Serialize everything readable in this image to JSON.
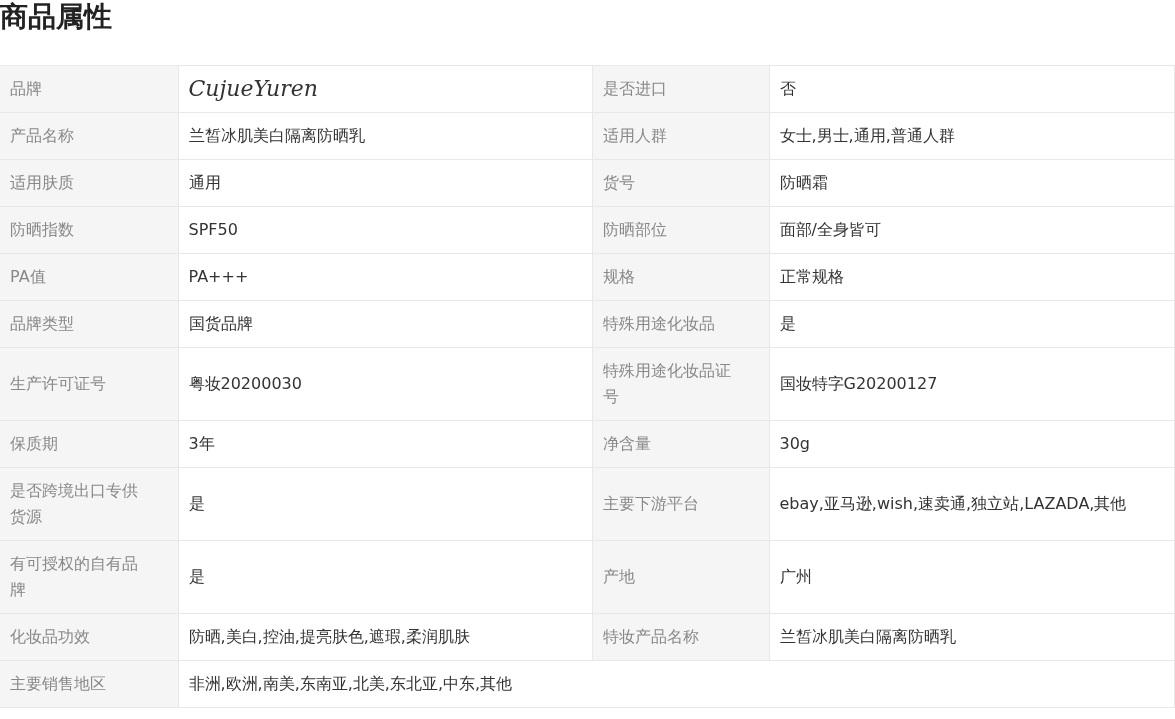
{
  "title": "商品属性",
  "rows": [
    [
      {
        "label": "品牌",
        "value": "CujueYuren",
        "kind": "brand"
      },
      {
        "label": "是否进口",
        "value": "否"
      }
    ],
    [
      {
        "label": "产品名称",
        "value": "兰皙冰肌美白隔离防晒乳"
      },
      {
        "label": "适用人群",
        "value": "女士,男士,通用,普通人群"
      }
    ],
    [
      {
        "label": "适用肤质",
        "value": "通用"
      },
      {
        "label": "货号",
        "value": "防晒霜"
      }
    ],
    [
      {
        "label": "防晒指数",
        "value": "SPF50"
      },
      {
        "label": "防晒部位",
        "value": "面部/全身皆可"
      }
    ],
    [
      {
        "label": "PA值",
        "value": "PA+++"
      },
      {
        "label": "规格",
        "value": "正常规格"
      }
    ],
    [
      {
        "label": "品牌类型",
        "value": "国货品牌"
      },
      {
        "label": "特殊用途化妆品",
        "value": "是"
      }
    ],
    [
      {
        "label": "生产许可证号",
        "value": "粤妆20200030"
      },
      {
        "label": "特殊用途化妆品证号",
        "value": "国妆特字G20200127"
      }
    ],
    [
      {
        "label": "保质期",
        "value": "3年"
      },
      {
        "label": "净含量",
        "value": "30g"
      }
    ],
    [
      {
        "label": "是否跨境出口专供货源",
        "value": "是"
      },
      {
        "label": "主要下游平台",
        "value": "ebay,亚马逊,wish,速卖通,独立站,LAZADA,其他"
      }
    ],
    [
      {
        "label": "有可授权的自有品牌",
        "value": "是"
      },
      {
        "label": "产地",
        "value": "广州"
      }
    ],
    [
      {
        "label": "化妆品功效",
        "value": "防晒,美白,控油,提亮肤色,遮瑕,柔润肌肤"
      },
      {
        "label": "特妆产品名称",
        "value": "兰皙冰肌美白隔离防晒乳"
      }
    ],
    [
      {
        "label": "主要销售地区",
        "value": "非洲,欧洲,南美,东南亚,北美,东北亚,中东,其他"
      }
    ]
  ]
}
